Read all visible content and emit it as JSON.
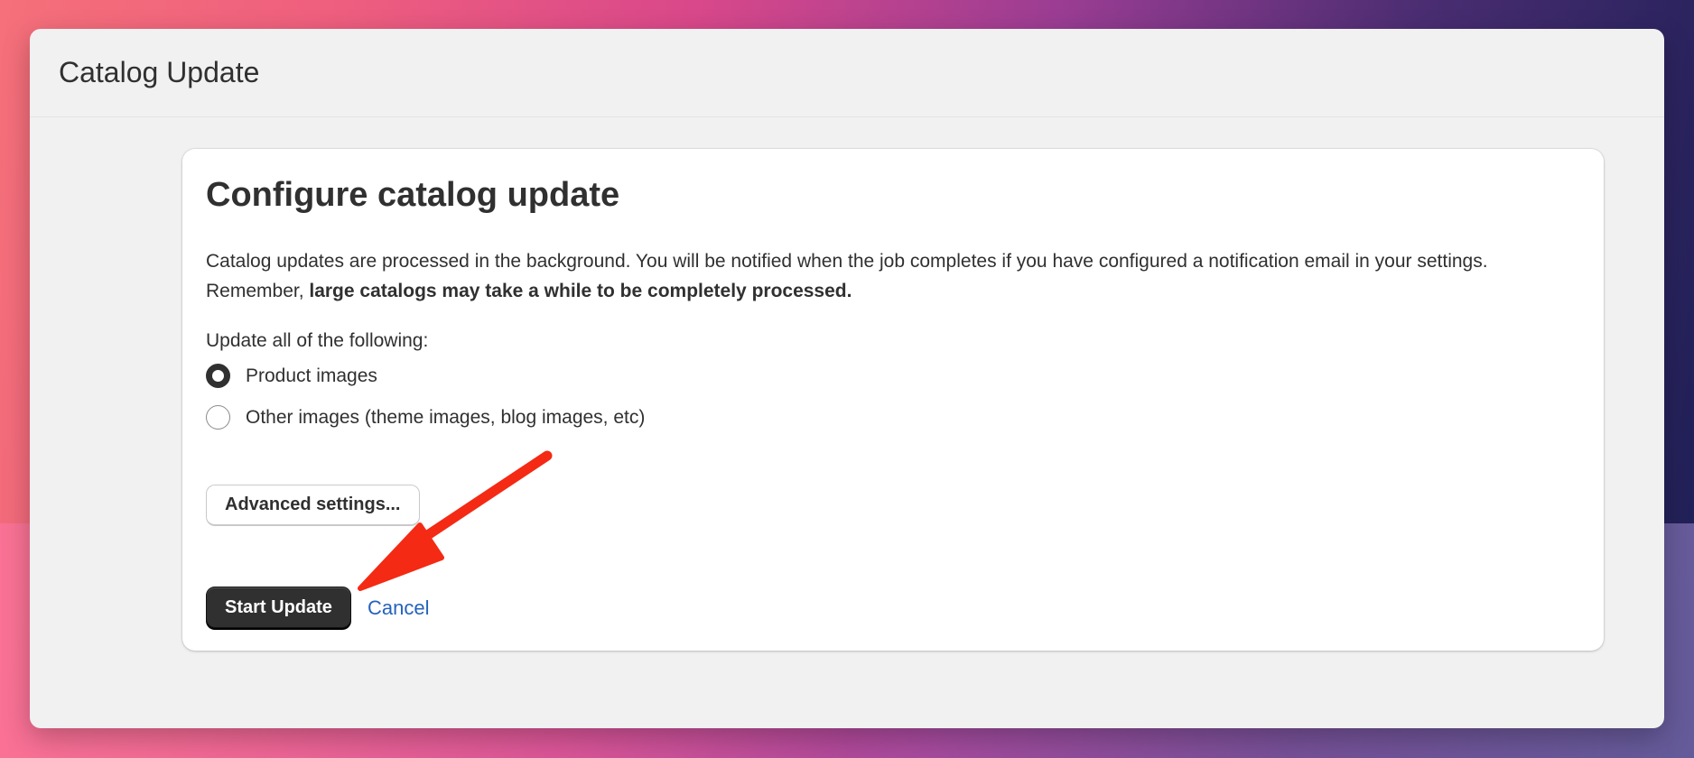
{
  "window": {
    "title": "Catalog Update"
  },
  "card": {
    "heading": "Configure catalog update",
    "description_plain": "Catalog updates are processed in the background. You will be notified when the job completes if you have configured a notification email in your settings. Remember, ",
    "description_bold": "large catalogs may take a while to be completely processed.",
    "group_label": "Update all of the following:",
    "options": [
      {
        "label": "Product images",
        "checked": true
      },
      {
        "label": "Other images (theme images, blog images, etc)",
        "checked": false
      }
    ],
    "advanced_button": "Advanced settings...",
    "start_button": "Start Update",
    "cancel_link": "Cancel"
  },
  "annotation": {
    "arrow_color": "#f42a14",
    "arrow_icon": "red-arrow-icon"
  },
  "colors": {
    "primary_button": "#303030",
    "link": "#2463bc",
    "text": "#303030"
  }
}
